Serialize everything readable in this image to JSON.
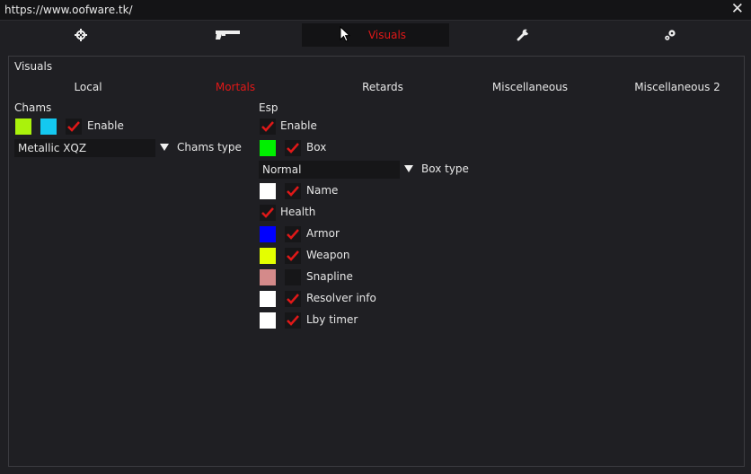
{
  "window": {
    "title": "https://www.oofware.tk/",
    "close_glyph": "✕"
  },
  "top_tabs": [
    {
      "icon": "crosshair-icon"
    },
    {
      "icon": "pistol-icon"
    },
    {
      "label": "Visuals",
      "active": true
    },
    {
      "icon": "wrench-icon"
    },
    {
      "icon": "gears-icon"
    }
  ],
  "panel": {
    "title": "Visuals",
    "subtabs": [
      "Local",
      "Mortals",
      "Retards",
      "Miscellaneous",
      "Miscellaneous 2"
    ],
    "active_subtab": "Mortals"
  },
  "chams": {
    "title": "Chams",
    "color1": "#aaf20c",
    "color2": "#14c8f0",
    "enable_label": "Enable",
    "enable_checked": true,
    "type_value": "Metallic XQZ",
    "type_label": "Chams type"
  },
  "esp": {
    "title": "Esp",
    "enable_label": "Enable",
    "enable_checked": true,
    "box_color": "#00f000",
    "box_label": "Box",
    "box_checked": true,
    "box_type_value": "Normal",
    "box_type_label": "Box type",
    "name_color": "#ffffff",
    "name_label": "Name",
    "name_checked": true,
    "health_label": "Health",
    "health_checked": true,
    "armor_color": "#0000ff",
    "armor_label": "Armor",
    "armor_checked": true,
    "weapon_color": "#e4ff00",
    "weapon_label": "Weapon",
    "weapon_checked": true,
    "snapline_color": "#d48a8a",
    "snapline_label": "Snapline",
    "snapline_checked": false,
    "resolver_color": "#ffffff",
    "resolver_label": "Resolver info",
    "resolver_checked": true,
    "lby_color": "#ffffff",
    "lby_label": "Lby timer",
    "lby_checked": true
  },
  "accent": "#e01818"
}
